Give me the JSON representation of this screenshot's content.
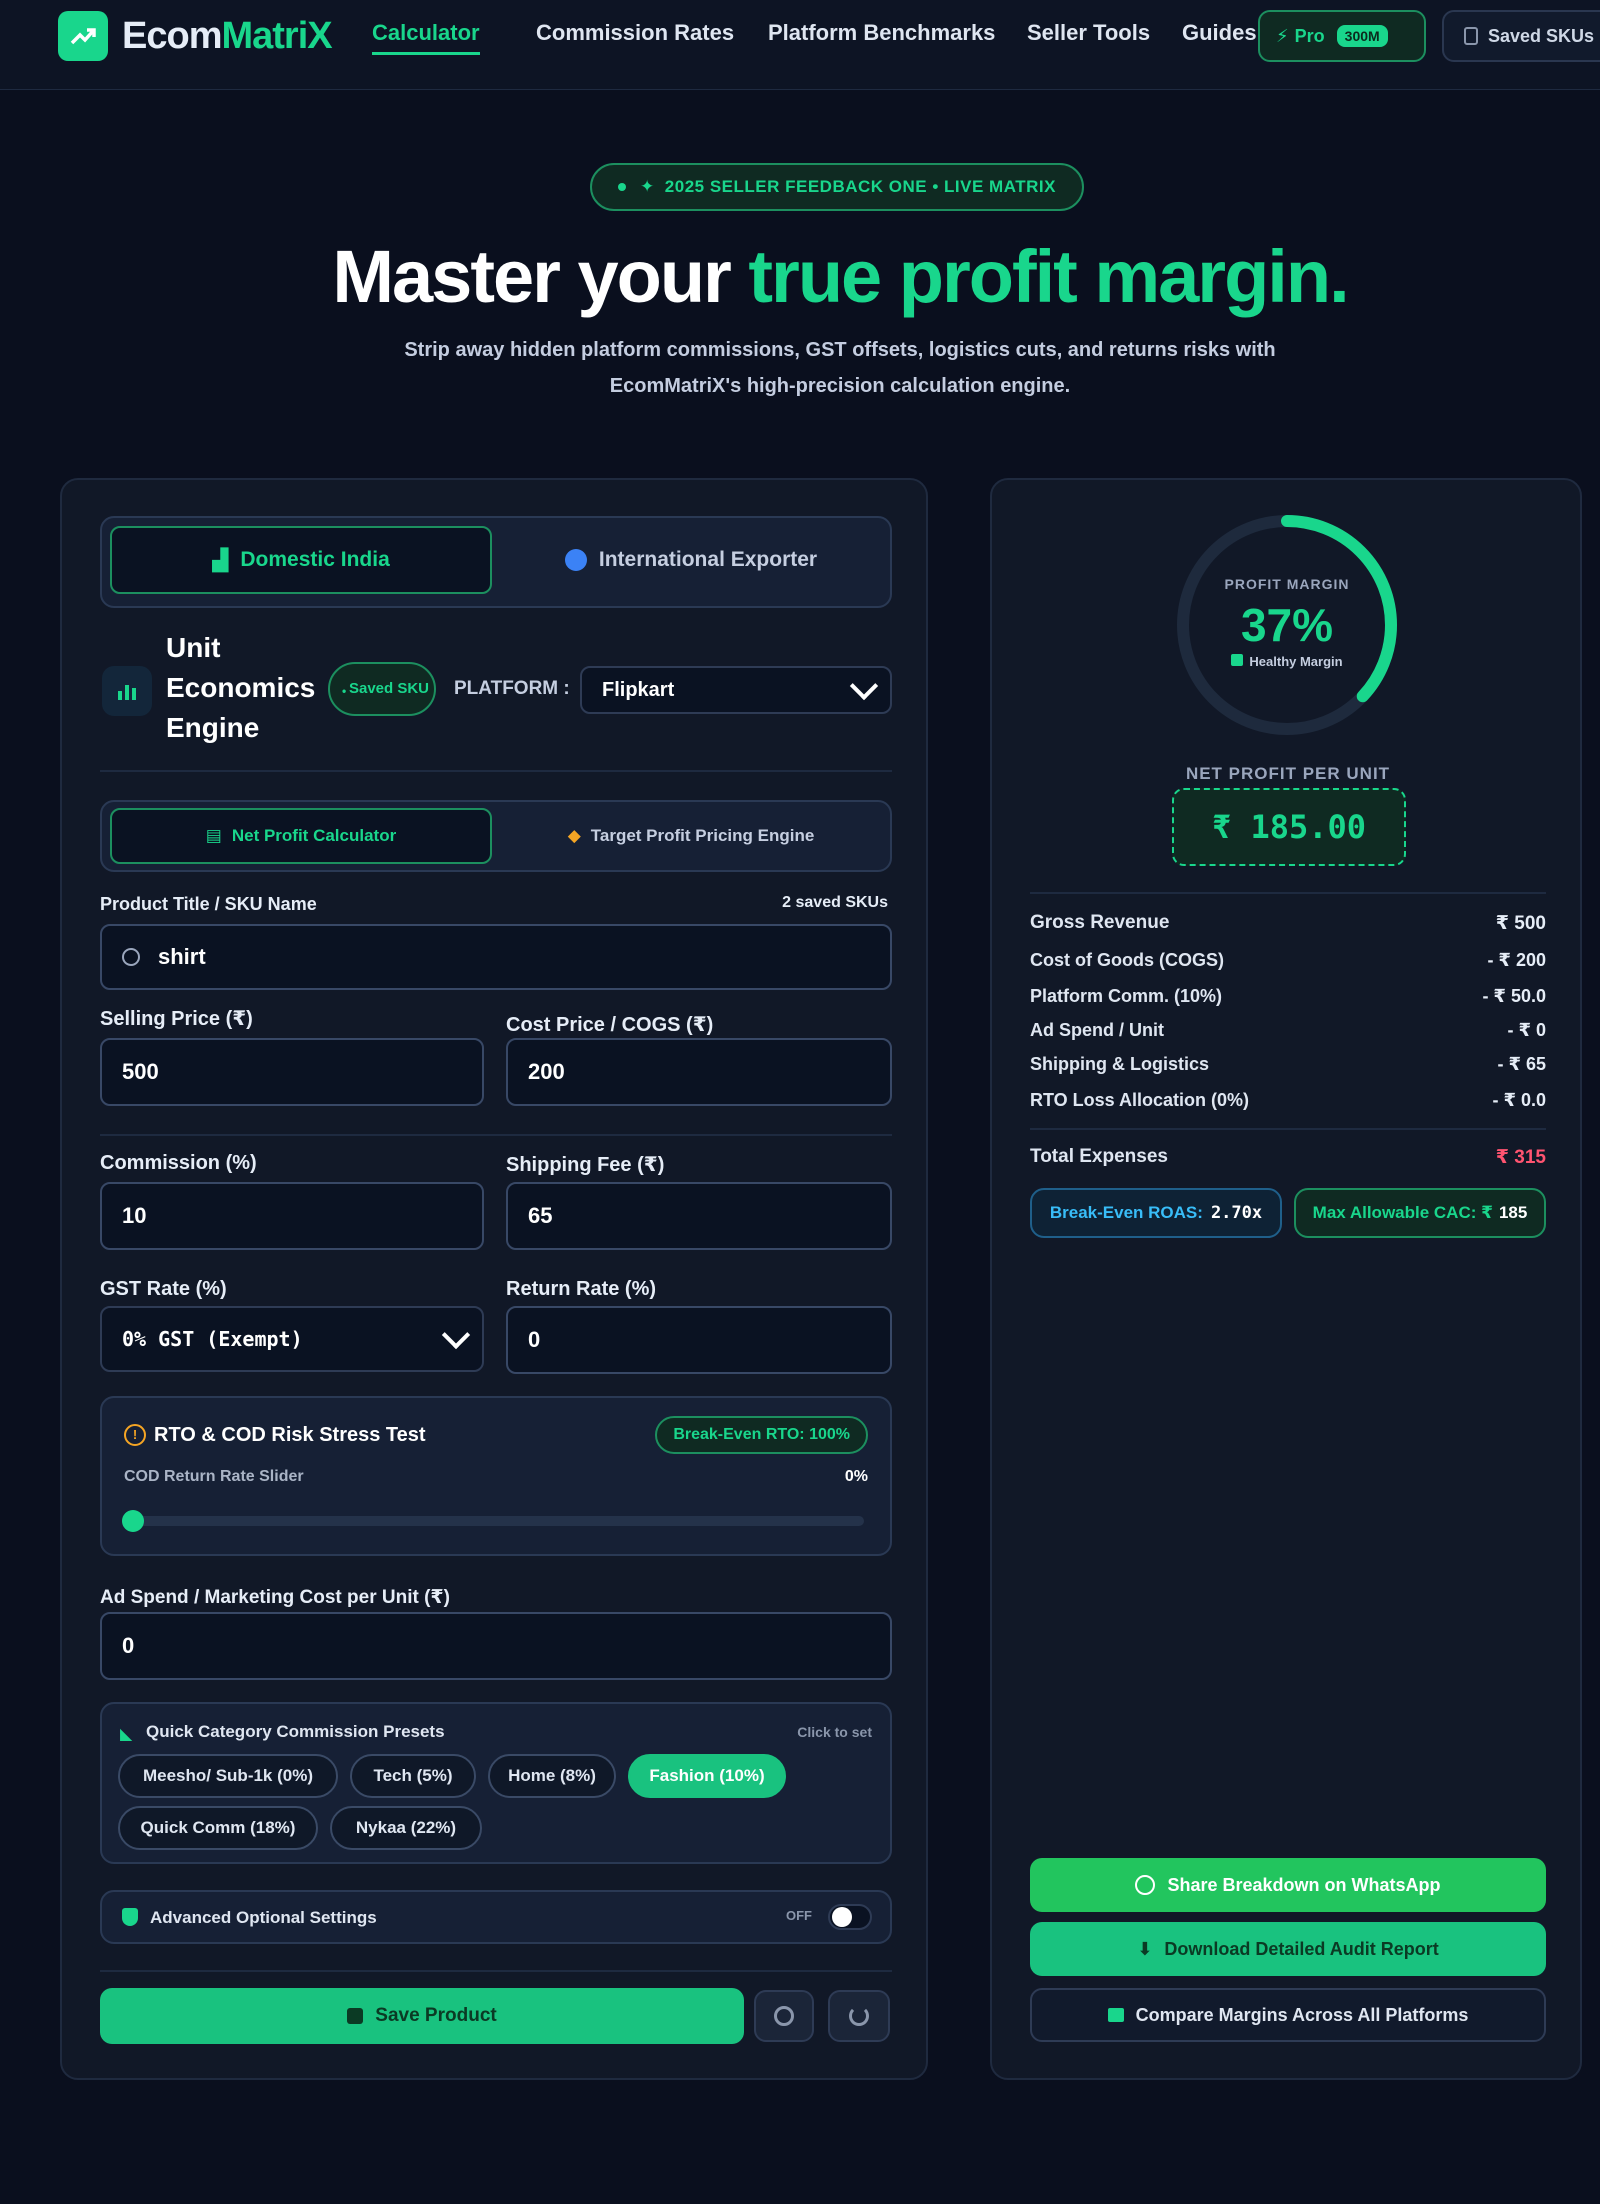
{
  "brand": {
    "name_part1": "Ecom",
    "name_part2": "MatriX"
  },
  "nav": {
    "links": [
      "Calculator",
      "Commission Rates",
      "Platform Benchmarks",
      "Seller Tools",
      "Guides"
    ],
    "pro_label": "Pro",
    "pro_badge": "300M",
    "saved_label": "Saved SKUs"
  },
  "hero": {
    "badge": "2025 SELLER FEEDBACK ONE • LIVE MATRIX",
    "title_part1": "Master your ",
    "title_part2": "true profit margin.",
    "subtitle_line1": "Strip away hidden platform commissions, GST offsets, logistics cuts, and returns risks with",
    "subtitle_line2": "EcomMatriX's high-precision calculation engine."
  },
  "calculator": {
    "mode_tabs": [
      "Domestic India",
      "International Exporter"
    ],
    "engine_title": "Unit Economics Engine",
    "saved_pill": "Saved SKU",
    "platform_label": "PLATFORM :",
    "platform_value": "Flipkart",
    "sub_tabs": [
      "Net Profit Calculator",
      "Target Profit Pricing Engine"
    ],
    "product_label": "Product Title / SKU Name",
    "saved_count": "2 saved SKUs",
    "product_value": "shirt",
    "selling_price_label": "Selling Price (₹)",
    "selling_price": "500",
    "cost_price_label": "Cost Price / COGS (₹)",
    "cost_price": "200",
    "commission_label": "Commission (%)",
    "commission": "10",
    "shipping_label": "Shipping Fee (₹)",
    "shipping": "65",
    "gst_label": "GST Rate (%)",
    "gst_value": "0% GST (Exempt)",
    "return_label": "Return Rate (%)",
    "return_rate": "0",
    "rto_title": "RTO & COD Risk Stress Test",
    "rto_badge": "Break-Even RTO: 100%",
    "rto_slider_label": "COD Return Rate Slider",
    "rto_slider_value": "0%",
    "rto_slider_level": 0,
    "adspend_label": "Ad Spend / Marketing Cost per Unit (₹)",
    "adspend": "0",
    "presets_title": "Quick Category Commission Presets",
    "presets_hint": "Click to set",
    "presets": [
      "Meesho/ Sub-1k (0%)",
      "Tech (5%)",
      "Home (8%)",
      "Fashion (10%)",
      "Quick Comm (18%)",
      "Nykaa (22%)"
    ],
    "advanced_label": "Advanced Optional Settings",
    "advanced_state": "OFF",
    "save_button": "Save Product"
  },
  "results": {
    "gauge_label": "PROFIT MARGIN",
    "gauge_value": "37%",
    "gauge_fraction": 0.37,
    "gauge_sub": "Healthy Margin",
    "net_profit_label": "NET PROFIT PER UNIT",
    "net_profit_value": "₹ 185.00",
    "breakdown": [
      {
        "label": "Gross Revenue",
        "value": "₹ 500"
      },
      {
        "label": "Cost of Goods (COGS)",
        "value": "- ₹ 200"
      },
      {
        "label": "Platform Comm. (10%)",
        "value": "- ₹ 50.0"
      },
      {
        "label": "Ad Spend / Unit",
        "value": "- ₹ 0"
      },
      {
        "label": "Shipping & Logistics",
        "value": "- ₹ 65"
      },
      {
        "label": "RTO Loss Allocation (0%)",
        "value": "- ₹ 0.0"
      }
    ],
    "total_label": "Total Expenses",
    "total_value": "₹ 315",
    "roas_label": "Break-Even ROAS:",
    "roas_value": "2.70x",
    "cac_label": "Max Allowable CAC: ₹",
    "cac_value": "185",
    "whatsapp_button": "Share Breakdown on WhatsApp",
    "download_button": "Download Detailed Audit Report",
    "compare_button": "Compare Margins Across All Platforms"
  },
  "colors": {
    "accent": "#19d68c",
    "background": "#0a0f1e",
    "card": "#111827",
    "danger": "#ff5470",
    "info": "#38bdf8"
  }
}
